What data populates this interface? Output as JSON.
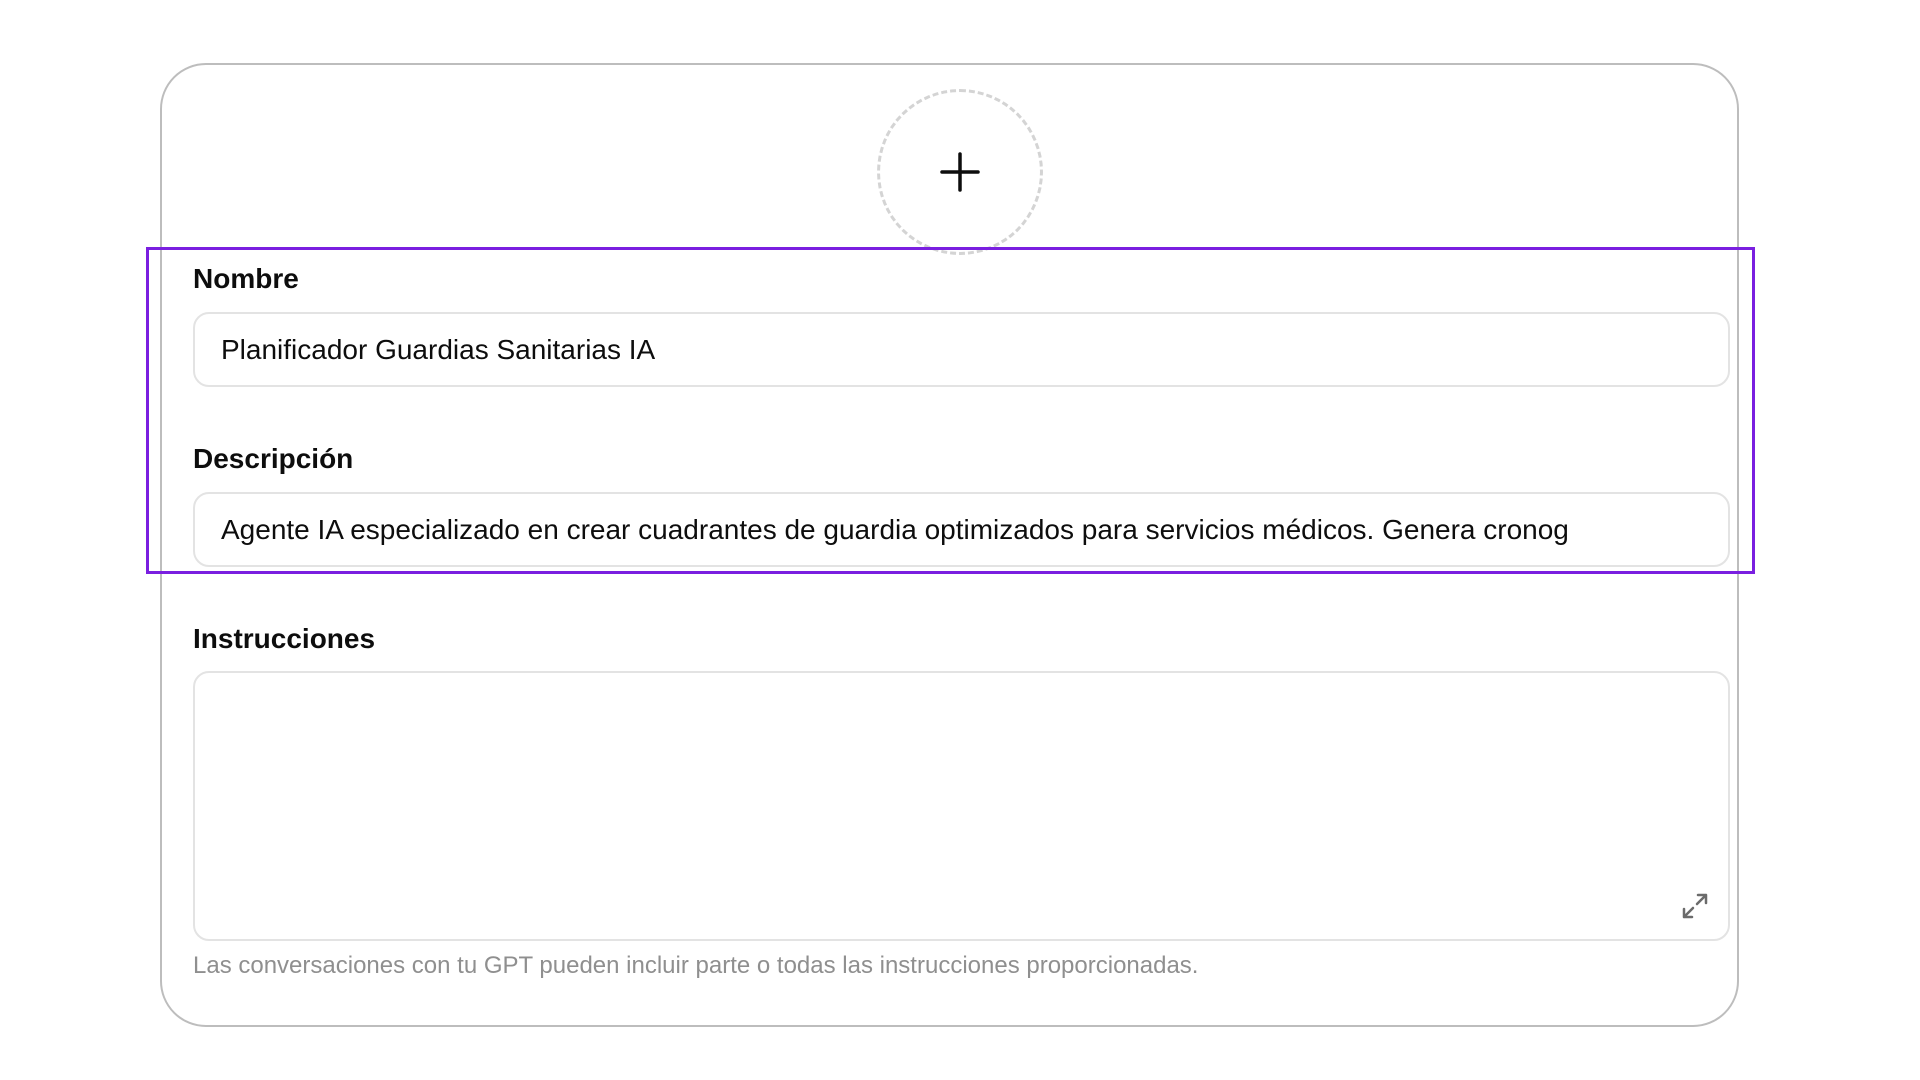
{
  "form": {
    "avatar_icon": "plus-icon",
    "name": {
      "label": "Nombre",
      "value": "Planificador Guardias Sanitarias IA"
    },
    "description": {
      "label": "Descripción",
      "value": "Agente IA especializado en crear cuadrantes de guardia optimizados para servicios médicos. Genera cronog"
    },
    "instructions": {
      "label": "Instrucciones",
      "value": "",
      "expand_icon": "expand-icon"
    },
    "hint": "Las conversaciones con tu GPT pueden incluir parte o todas las instrucciones proporcionadas."
  },
  "colors": {
    "highlight": "#7a1fe0",
    "card_border": "#bdbdbd",
    "input_border": "#e3e3e3",
    "hint_text": "#8f8f8f"
  }
}
